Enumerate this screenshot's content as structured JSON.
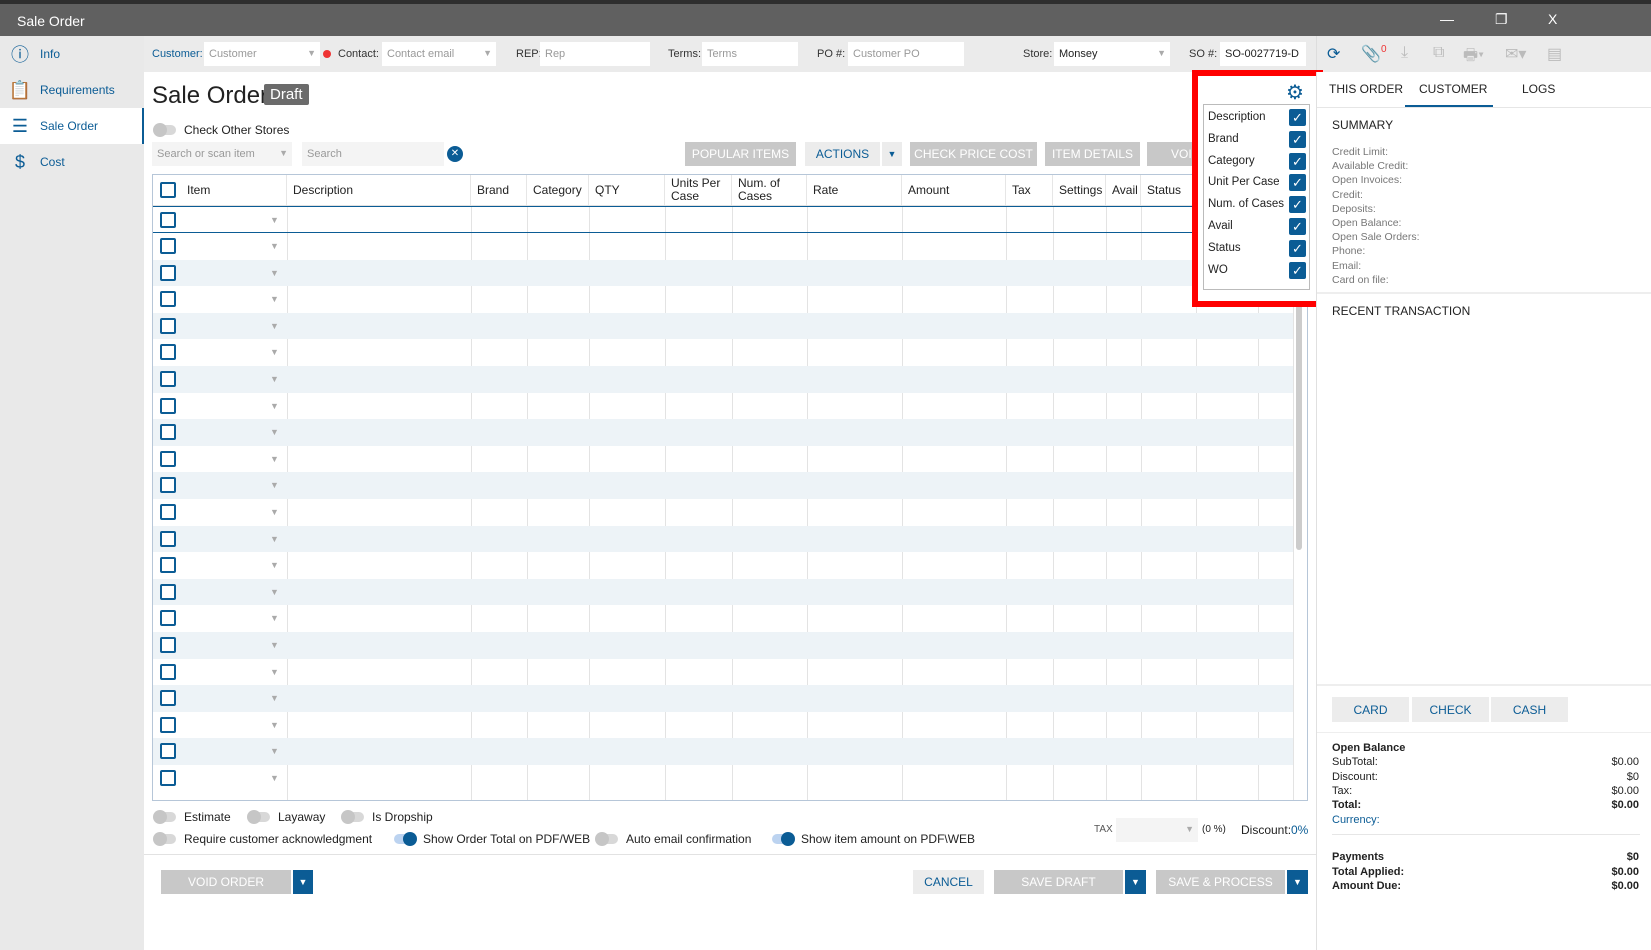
{
  "window": {
    "title": "Sale Order",
    "minimize": "—",
    "restore": "❐",
    "close": "X"
  },
  "sidebar": {
    "items": [
      {
        "label": "Info",
        "icon": "ⓘ"
      },
      {
        "label": "Requirements",
        "icon": "📋"
      },
      {
        "label": "Sale Order",
        "icon": "☰"
      },
      {
        "label": "Cost",
        "icon": "$"
      }
    ]
  },
  "fields": {
    "customer_label": "Customer:",
    "customer_placeholder": "Customer",
    "contact_label": "Contact:",
    "contact_placeholder": "Contact email",
    "rep_label": "REP:",
    "rep_placeholder": "Rep",
    "terms_label": "Terms:",
    "terms_placeholder": "Terms",
    "po_label": "PO #:",
    "po_placeholder": "Customer PO",
    "store_label": "Store:",
    "store_value": "Monsey",
    "so_label": "SO #:",
    "so_value": "SO-0027719-D",
    "attach_count": "0"
  },
  "page": {
    "title": "Sale Order",
    "status": "Draft",
    "check_other_stores": "Check Other Stores",
    "search_item_placeholder": "Search or scan item",
    "search_placeholder": "Search"
  },
  "actions": {
    "popular": "POPULAR ITEMS",
    "actions": "ACTIONS",
    "check_price": "CHECK PRICE COST",
    "item_details": "ITEM DETAILS",
    "void": "VOID"
  },
  "table": {
    "columns": [
      "Item",
      "Description",
      "Brand",
      "Category",
      "QTY",
      "Units Per Case",
      "Num. of Cases",
      "Rate",
      "Amount",
      "Tax",
      "Settings",
      "Avail",
      "Status"
    ]
  },
  "column_settings": [
    {
      "label": "Description",
      "checked": true
    },
    {
      "label": "Brand",
      "checked": true
    },
    {
      "label": "Category",
      "checked": true
    },
    {
      "label": "Unit Per Case",
      "checked": true
    },
    {
      "label": "Num. of Cases",
      "checked": true
    },
    {
      "label": "Avail",
      "checked": true
    },
    {
      "label": "Status",
      "checked": true
    },
    {
      "label": "WO",
      "checked": true
    }
  ],
  "options": {
    "estimate": "Estimate",
    "layaway": "Layaway",
    "dropship": "Is Dropship",
    "require_ack": "Require customer acknowledgment",
    "show_total": "Show Order Total on PDF/WEB",
    "auto_email": "Auto email confirmation",
    "show_item_amount": "Show item amount on PDF\\WEB",
    "tax_label": "TAX",
    "tax_pct": "(0 %)",
    "discount_label": "Discount:",
    "discount_value": "0%"
  },
  "footer": {
    "void_order": "VOID ORDER",
    "cancel": "CANCEL",
    "save_draft": "SAVE DRAFT",
    "save_process": "SAVE & PROCESS"
  },
  "right_panel": {
    "tabs": [
      "THIS ORDER",
      "CUSTOMER",
      "LOGS"
    ],
    "summary_title": "SUMMARY",
    "summary": [
      "Credit Limit:",
      "Available Credit:",
      "Open Invoices:",
      "Credit:",
      "Deposits:",
      "Open Balance:",
      "Open Sale Orders:",
      "Phone:",
      "Email:",
      "Card on file:"
    ],
    "recent": "RECENT TRANSACTION",
    "pay_buttons": [
      "CARD",
      "CHECK",
      "CASH"
    ],
    "totals": {
      "open_balance": "Open Balance",
      "subtotal_label": "SubTotal:",
      "subtotal": "$0.00",
      "discount_label": "Discount:",
      "discount": "$0",
      "tax_label": "Tax:",
      "tax": "$0.00",
      "total_label": "Total:",
      "total": "$0.00",
      "currency_label": "Currency:",
      "payments_label": "Payments",
      "payments": "$0",
      "applied_label": "Total Applied:",
      "applied": "$0.00",
      "due_label": "Amount Due:",
      "due": "$0.00"
    }
  }
}
